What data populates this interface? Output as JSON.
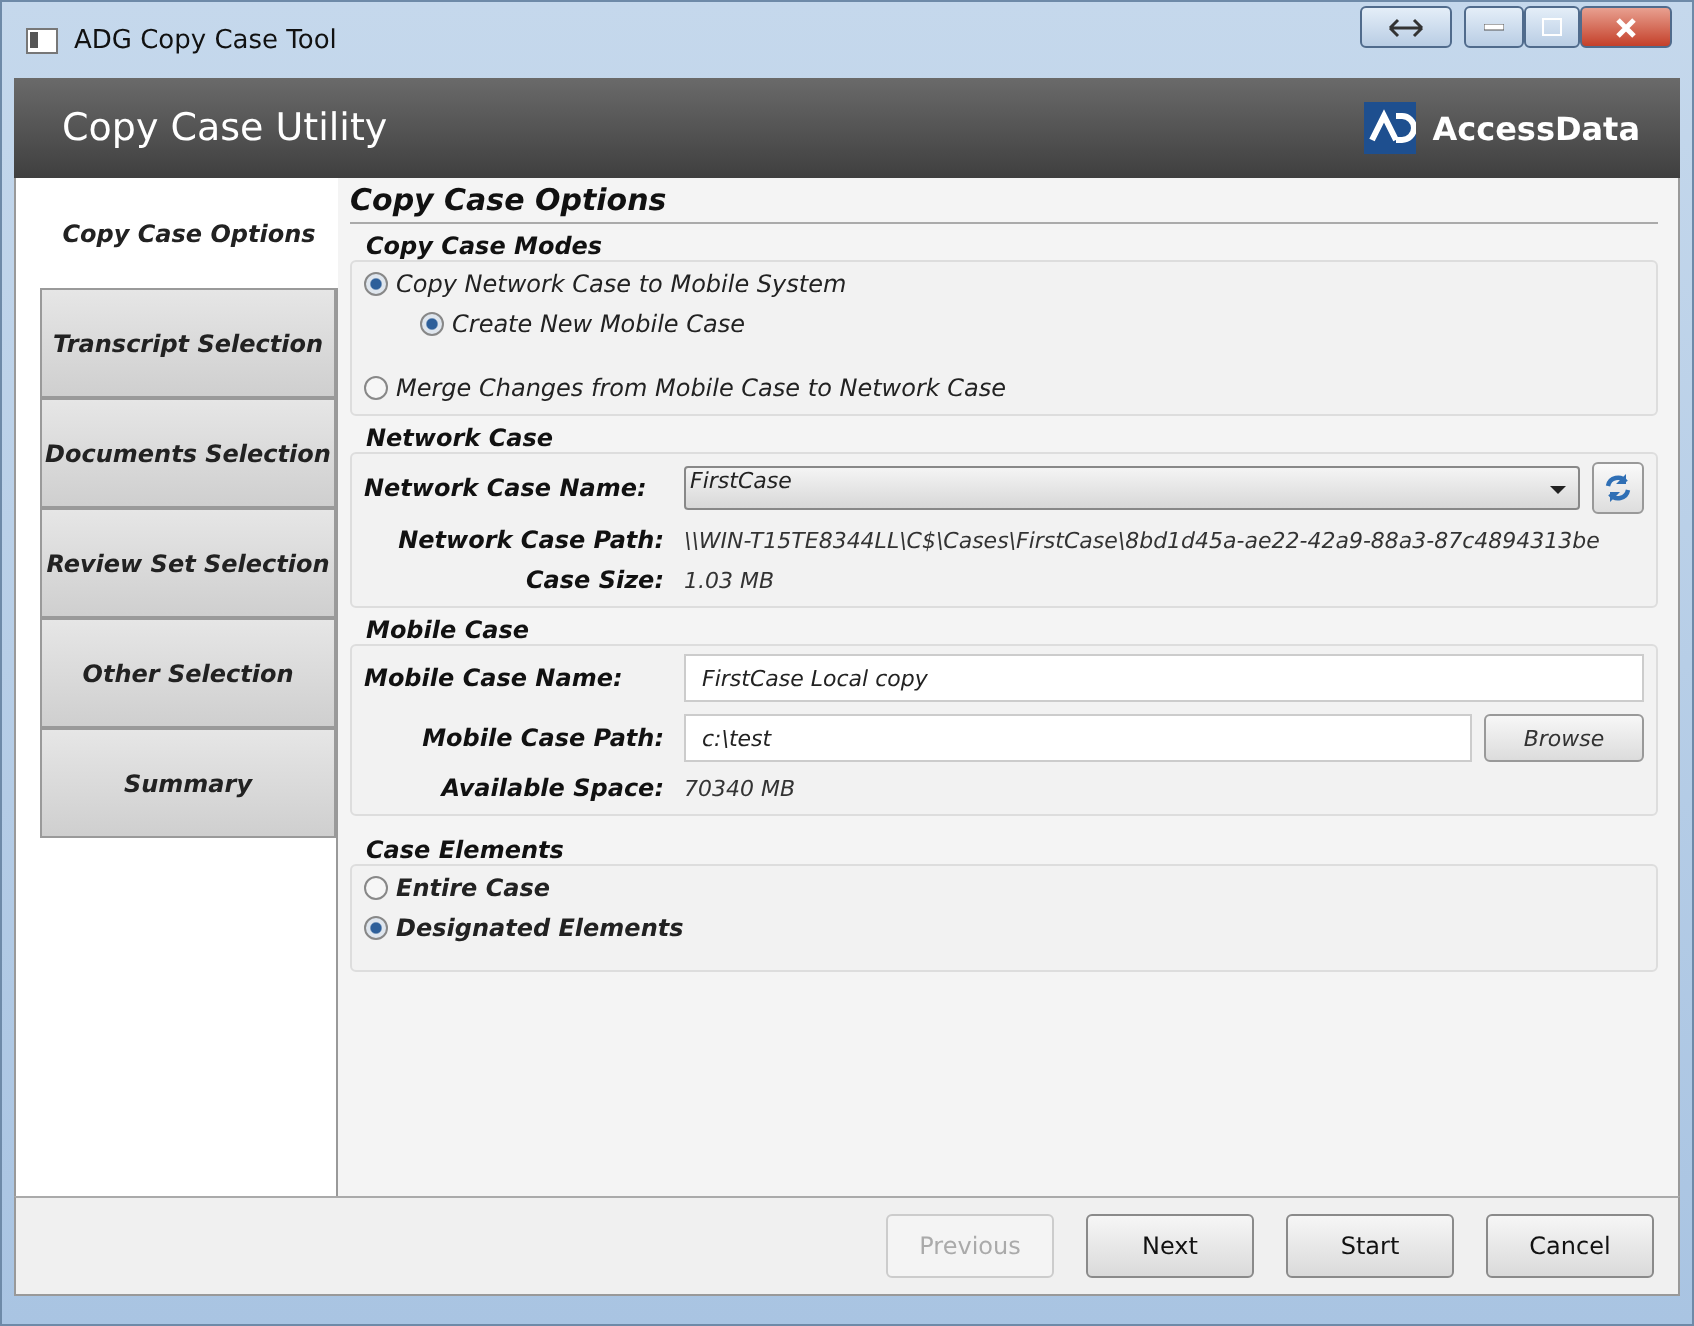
{
  "window": {
    "title": "ADG Copy Case Tool"
  },
  "header": {
    "title": "Copy Case Utility",
    "brand": "AccessData"
  },
  "sidebar": {
    "items": [
      {
        "label": "Copy Case Options",
        "selected": true
      },
      {
        "label": "Transcript Selection",
        "selected": false
      },
      {
        "label": "Documents Selection",
        "selected": false
      },
      {
        "label": "Review Set  Selection",
        "selected": false
      },
      {
        "label": "Other Selection",
        "selected": false
      },
      {
        "label": "Summary",
        "selected": false
      }
    ]
  },
  "content": {
    "title": "Copy Case Options",
    "modes": {
      "title": "Copy Case Modes",
      "options": [
        {
          "label": "Copy Network Case to Mobile System",
          "selected": true,
          "children": [
            {
              "label": "Create New Mobile  Case",
              "selected": true
            }
          ]
        },
        {
          "label": "Merge Changes from Mobile Case to Network Case",
          "selected": false
        }
      ]
    },
    "network": {
      "title": "Network Case",
      "name_label": "Network  Case Name:",
      "name_value": "FirstCase",
      "path_label": "Network  Case Path:",
      "path_value": "\\\\WIN-T15TE8344LL\\C$\\Cases\\FirstCase\\8bd1d45a-ae22-42a9-88a3-87c4894313be",
      "size_label": "Case Size:",
      "size_value": "1.03 MB"
    },
    "mobile": {
      "title": "Mobile Case",
      "name_label": "Mobile  Case Name:",
      "name_value": "FirstCase Local copy",
      "path_label": "Mobile  Case Path:",
      "path_value": "c:\\test",
      "browse": "Browse",
      "space_label": "Available Space:",
      "space_value": "70340 MB"
    },
    "elements": {
      "title": "Case Elements",
      "options": [
        {
          "label": "Entire Case",
          "selected": false
        },
        {
          "label": "Designated Elements",
          "selected": true
        }
      ]
    }
  },
  "footer": {
    "buttons": [
      {
        "label": "Previous",
        "disabled": true
      },
      {
        "label": "Next",
        "disabled": false
      },
      {
        "label": "Start",
        "disabled": false
      },
      {
        "label": "Cancel",
        "disabled": false
      }
    ]
  }
}
